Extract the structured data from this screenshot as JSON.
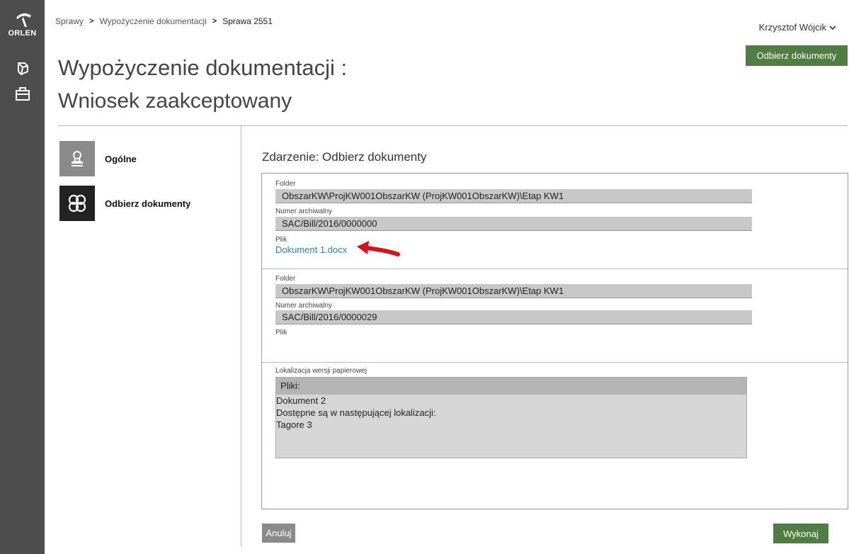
{
  "brand": {
    "name": "ORLEN"
  },
  "breadcrumb": {
    "items": [
      "Sprawy",
      "Wypożyczenie dokumentacji"
    ],
    "current": "Sprawa 2551"
  },
  "user": {
    "name": "Krzysztof Wójcik"
  },
  "header": {
    "action_label": "Odbierz dokumenty",
    "title": "Wypożyczenie dokumentacji :",
    "subtitle": "Wniosek zaakceptowany"
  },
  "steps": [
    {
      "label": "Ogólne",
      "icon": "stamp-icon"
    },
    {
      "label": "Odbierz dokumenty",
      "icon": "flower-icon"
    }
  ],
  "event": {
    "title": "Zdarzenie: Odbierz dokumenty",
    "sections": [
      {
        "folder_label": "Folder",
        "folder_value": "ObszarKW\\ProjKW001ObszarKW (ProjKW001ObszarKW)\\Etap KW1",
        "archive_label": "Numer archiwalny",
        "archive_value": "SAC/Bill/2016/0000000",
        "file_label": "Plik",
        "file_link": "Dokument 1.docx"
      },
      {
        "folder_label": "Folder",
        "folder_value": "ObszarKW\\ProjKW001ObszarKW (ProjKW001ObszarKW)\\Etap KW1",
        "archive_label": "Numer archiwalny",
        "archive_value": "SAC/Bill/2016/0000029",
        "file_label": "Plik"
      }
    ],
    "paper_location": {
      "label": "Lokalizacja wersji papierowej",
      "head": "Pliki:",
      "lines": [
        "Dokument 2",
        "Dostępne są w następującej lokalizacji:",
        "Tagore 3"
      ]
    }
  },
  "buttons": {
    "cancel": "Anuluj",
    "execute": "Wykonaj"
  },
  "colors": {
    "rail": "#4d4d4d",
    "primary": "#4f7d43",
    "link": "#2a7fc0",
    "cancel": "#8a8a8a",
    "annotation_arrow": "#d4141b"
  }
}
